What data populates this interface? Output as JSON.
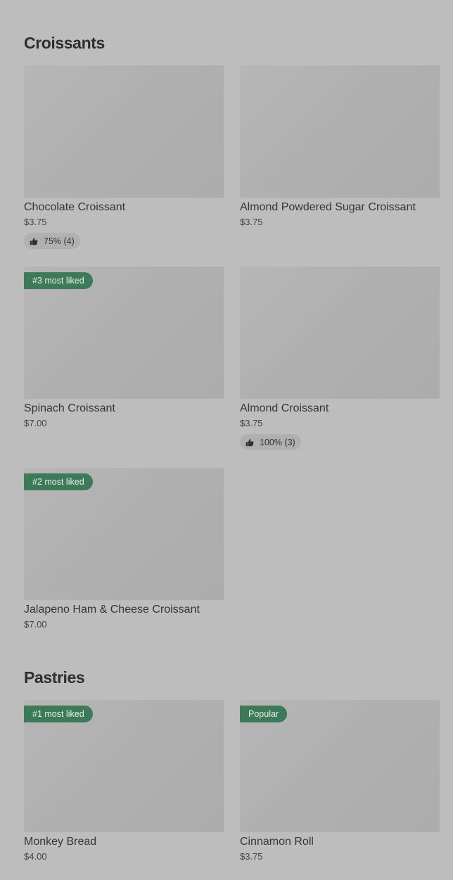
{
  "sections": [
    {
      "title": "Croissants",
      "items": [
        {
          "name": "Chocolate Croissant",
          "price": "$3.75",
          "rating": "75% (4)"
        },
        {
          "name": "Almond Powdered Sugar Croissant",
          "price": "$3.75"
        },
        {
          "name": "Spinach Croissant",
          "price": "$7.00",
          "tag": "#3 most liked"
        },
        {
          "name": "Almond Croissant",
          "price": "$3.75",
          "rating": "100% (3)"
        },
        {
          "name": "Jalapeno Ham & Cheese Croissant",
          "price": "$7.00",
          "tag": "#2 most liked"
        }
      ]
    },
    {
      "title": "Pastries",
      "items": [
        {
          "name": "Monkey Bread",
          "price": "$4.00",
          "tag": "#1 most liked"
        },
        {
          "name": "Cinnamon Roll",
          "price": "$3.75",
          "tag": "Popular"
        }
      ]
    }
  ],
  "colors": {
    "background": "#bdbdbd",
    "tag_background": "#3d7a5a",
    "image_placeholder": "#b2b2b2",
    "rating_pill": "#b0b0b0"
  },
  "icons": {
    "rating": "thumbs-up-icon"
  }
}
